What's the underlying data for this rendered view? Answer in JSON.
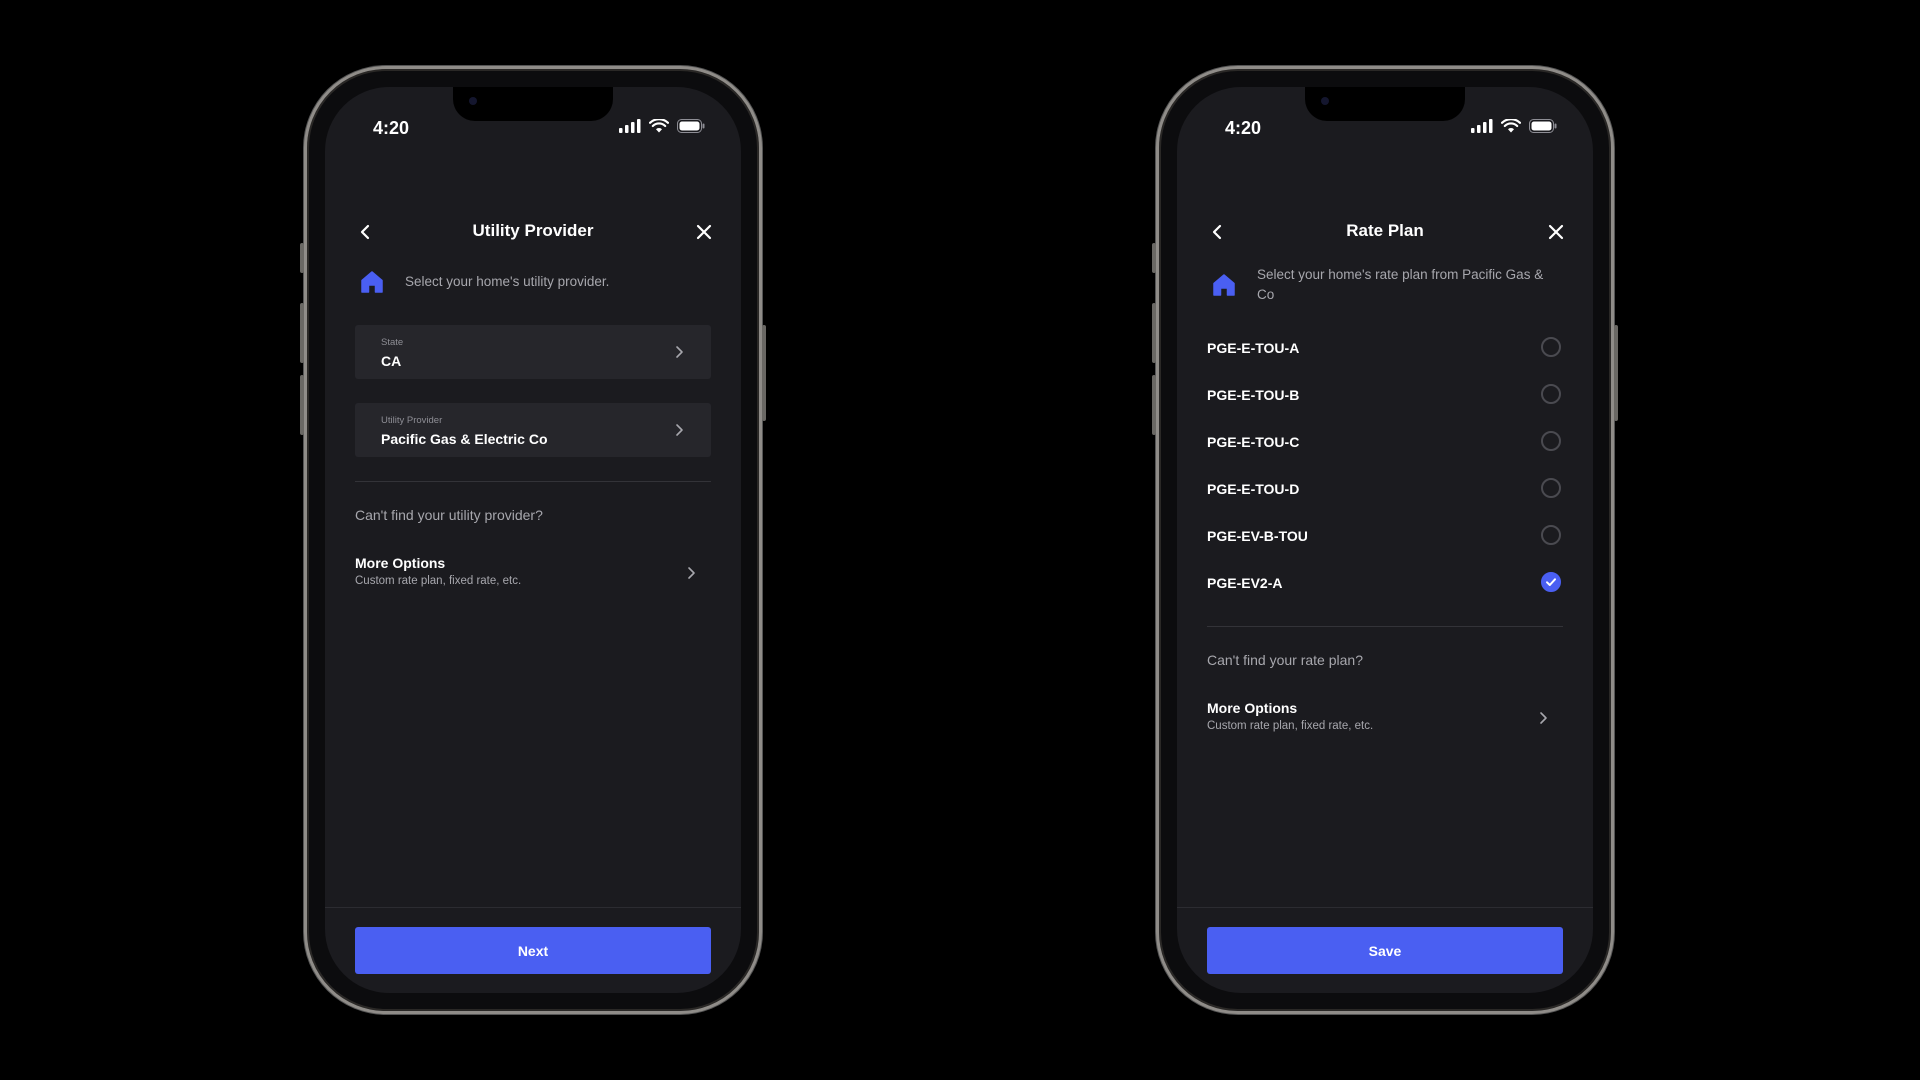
{
  "colors": {
    "accent": "#4a5ff2",
    "background": "#1b1b1f",
    "field": "#26262b",
    "muted_text": "#a7a7ad"
  },
  "left_screen": {
    "status_time": "4:20",
    "title": "Utility Provider",
    "back_icon": "chevron-left-icon",
    "close_icon": "close-icon",
    "intro_icon": "home-icon",
    "intro_text": "Select your home's utility provider.",
    "state_field": {
      "label": "State",
      "value": "CA"
    },
    "provider_field": {
      "label": "Utility Provider",
      "value": "Pacific Gas & Electric Co"
    },
    "cant_find": "Can't find your utility provider?",
    "more_options": {
      "title": "More Options",
      "subtitle": "Custom rate plan, fixed rate, etc."
    },
    "primary_button": "Next"
  },
  "right_screen": {
    "status_time": "4:20",
    "title": "Rate Plan",
    "back_icon": "chevron-left-icon",
    "close_icon": "close-icon",
    "intro_icon": "home-icon",
    "intro_text": "Select your home's rate plan from Pacific Gas & Co",
    "rate_plans": [
      {
        "label": "PGE-E-TOU-A",
        "selected": false
      },
      {
        "label": "PGE-E-TOU-B",
        "selected": false
      },
      {
        "label": "PGE-E-TOU-C",
        "selected": false
      },
      {
        "label": "PGE-E-TOU-D",
        "selected": false
      },
      {
        "label": "PGE-EV-B-TOU",
        "selected": false
      },
      {
        "label": "PGE-EV2-A",
        "selected": true
      }
    ],
    "cant_find": "Can't find your rate plan?",
    "more_options": {
      "title": "More Options",
      "subtitle": "Custom rate plan, fixed rate, etc."
    },
    "primary_button": "Save"
  }
}
